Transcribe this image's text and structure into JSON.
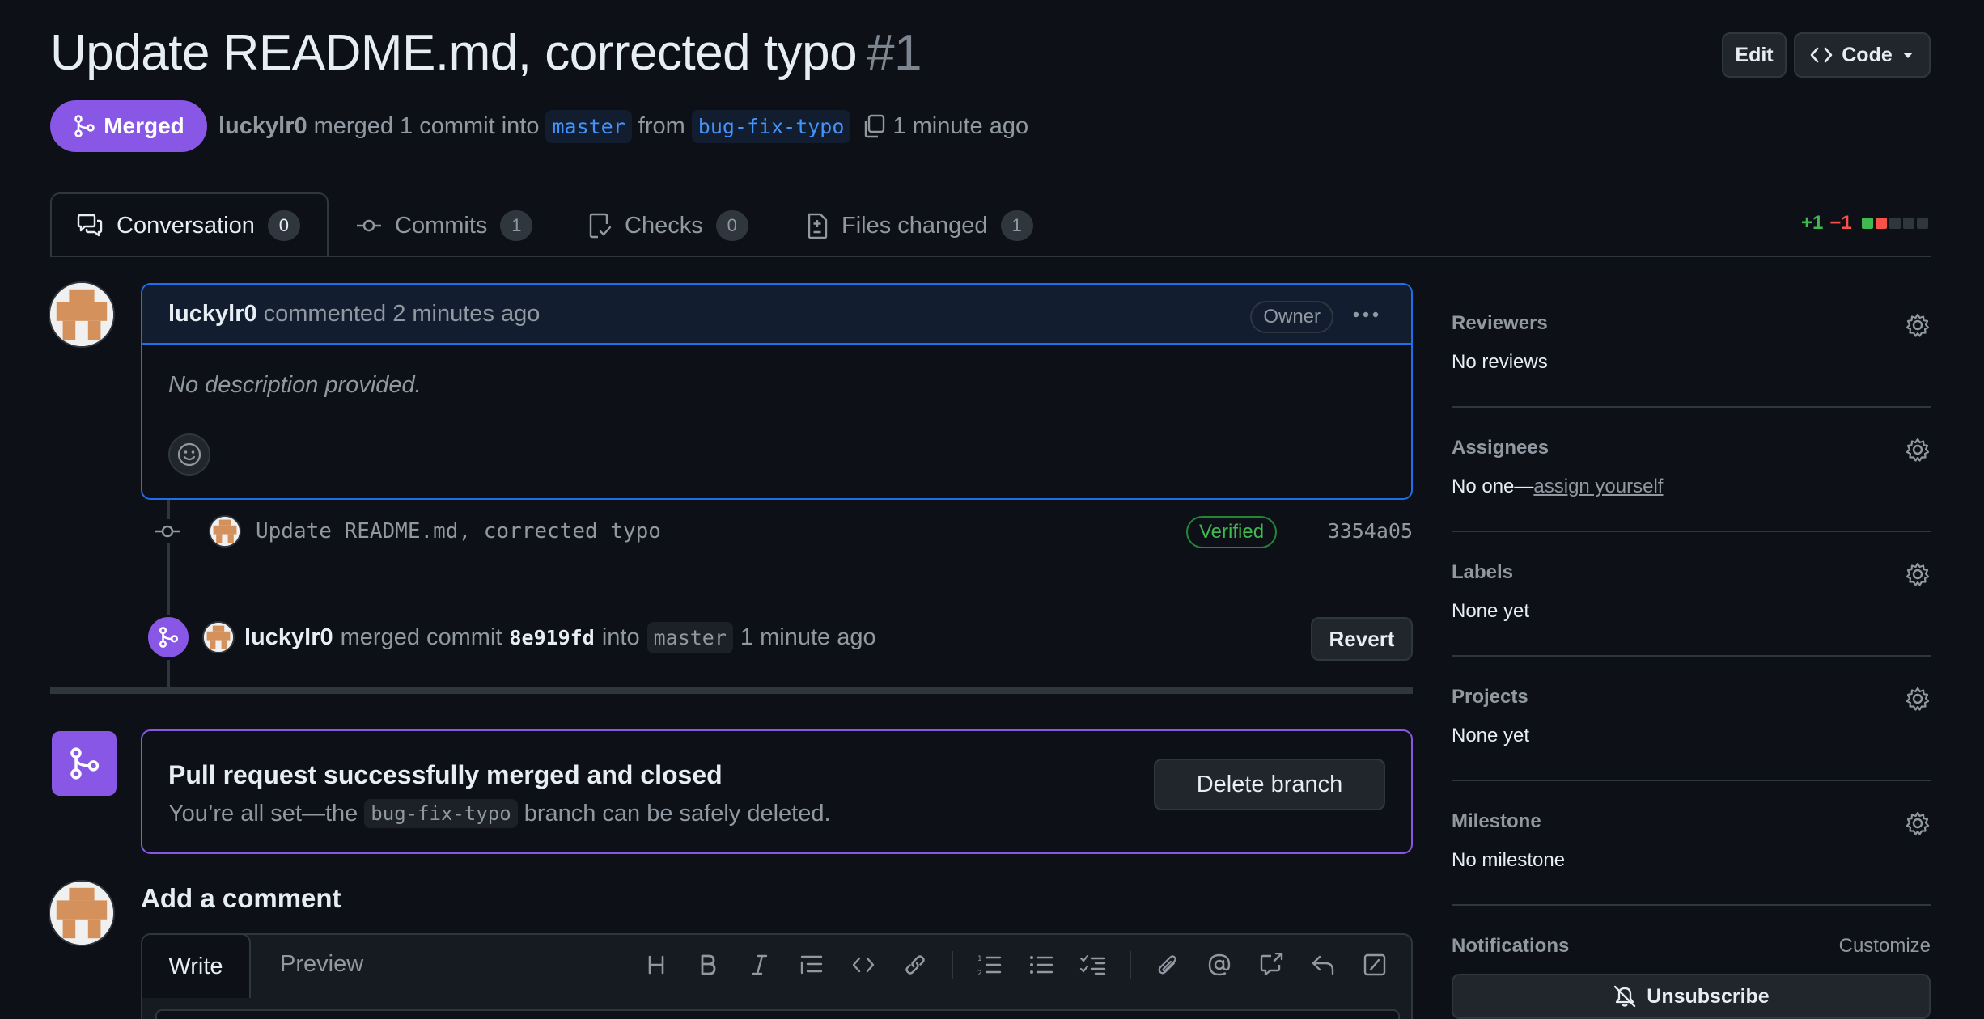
{
  "header": {
    "title": "Update README.md, corrected typo",
    "number": "#1",
    "edit_label": "Edit",
    "code_label": "Code"
  },
  "status": {
    "badge": "Merged",
    "author": "luckylr0",
    "text_merged": "merged 1 commit into",
    "target_branch": "master",
    "text_from": "from",
    "source_branch": "bug-fix-typo",
    "time": "1 minute ago"
  },
  "tabs": [
    {
      "label": "Conversation",
      "count": "0"
    },
    {
      "label": "Commits",
      "count": "1"
    },
    {
      "label": "Checks",
      "count": "0"
    },
    {
      "label": "Files changed",
      "count": "1"
    }
  ],
  "diffstat": {
    "additions": "+1",
    "deletions": "−1"
  },
  "comment": {
    "author": "luckylr0",
    "action": "commented 2 minutes ago",
    "role": "Owner",
    "body": "No description provided."
  },
  "commit": {
    "message": "Update README.md, corrected typo",
    "verified": "Verified",
    "sha": "3354a05"
  },
  "merge_event": {
    "author": "luckylr0",
    "text1": "merged commit",
    "sha": "8e919fd",
    "text2": "into",
    "target": "master",
    "time": "1 minute ago",
    "revert_label": "Revert"
  },
  "merge_status": {
    "title": "Pull request successfully merged and closed",
    "text1": "You’re all set—the",
    "branch": "bug-fix-typo",
    "text2": "branch can be safely deleted.",
    "delete_label": "Delete branch"
  },
  "add_comment": {
    "title": "Add a comment",
    "write_tab": "Write",
    "preview_tab": "Preview"
  },
  "sidebar": {
    "reviewers": {
      "title": "Reviewers",
      "value": "No reviews"
    },
    "assignees": {
      "title": "Assignees",
      "value_prefix": "No one—",
      "value_link": "assign yourself"
    },
    "labels": {
      "title": "Labels",
      "value": "None yet"
    },
    "projects": {
      "title": "Projects",
      "value": "None yet"
    },
    "milestone": {
      "title": "Milestone",
      "value": "No milestone"
    },
    "notifications": {
      "title": "Notifications",
      "customize": "Customize",
      "unsubscribe": "Unsubscribe"
    }
  },
  "colors": {
    "background": "#0d1117",
    "merged_purple": "#8957e5",
    "accent_blue": "#1f6feb",
    "success_green": "#3fb950",
    "danger_red": "#f85149"
  },
  "icons": [
    "git-merge-icon",
    "copy-icon",
    "comment-discussion-icon",
    "git-commit-icon",
    "checklist-icon",
    "file-diff-icon",
    "kebab-horizontal-icon",
    "smiley-icon",
    "gear-icon",
    "bell-slash-icon",
    "triangle-down-icon",
    "code-icon"
  ]
}
